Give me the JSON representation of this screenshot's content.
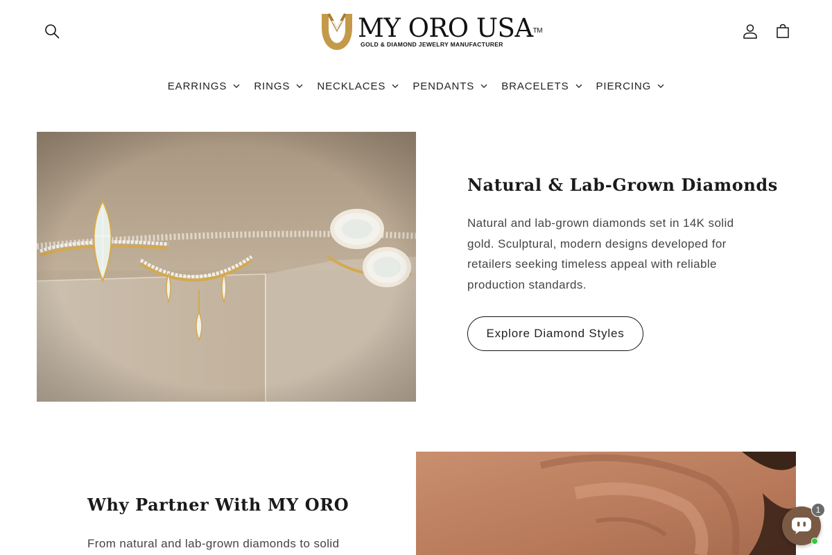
{
  "header": {
    "logo": {
      "text": "MY ORO USA",
      "trademark": "TM",
      "tagline": "GOLD & DIAMOND JEWELRY MANUFACTURER"
    },
    "icons": [
      "search-icon",
      "account-icon",
      "cart-icon"
    ]
  },
  "nav": {
    "items": [
      {
        "label": "EARRINGS"
      },
      {
        "label": "RINGS"
      },
      {
        "label": "NECKLACES"
      },
      {
        "label": "PENDANTS"
      },
      {
        "label": "BRACELETS"
      },
      {
        "label": "PIERCING"
      }
    ]
  },
  "hero": {
    "title": "Natural & Lab-Grown Diamonds",
    "description": "Natural and lab-grown diamonds set in 14K solid gold. Sculptural, modern designs developed for retailers seeking timeless appeal with reliable production standards.",
    "button_label": "Explore Diamond Styles"
  },
  "why": {
    "title": "Why Partner With MY ORO",
    "description": "From natural and lab-grown diamonds to solid"
  },
  "chat": {
    "badge_count": "1"
  },
  "colors": {
    "gold": "#c49a4a",
    "text": "#121212",
    "muted_text": "#444444",
    "chat_button": "#7a5a44",
    "online": "#2ecc40"
  }
}
